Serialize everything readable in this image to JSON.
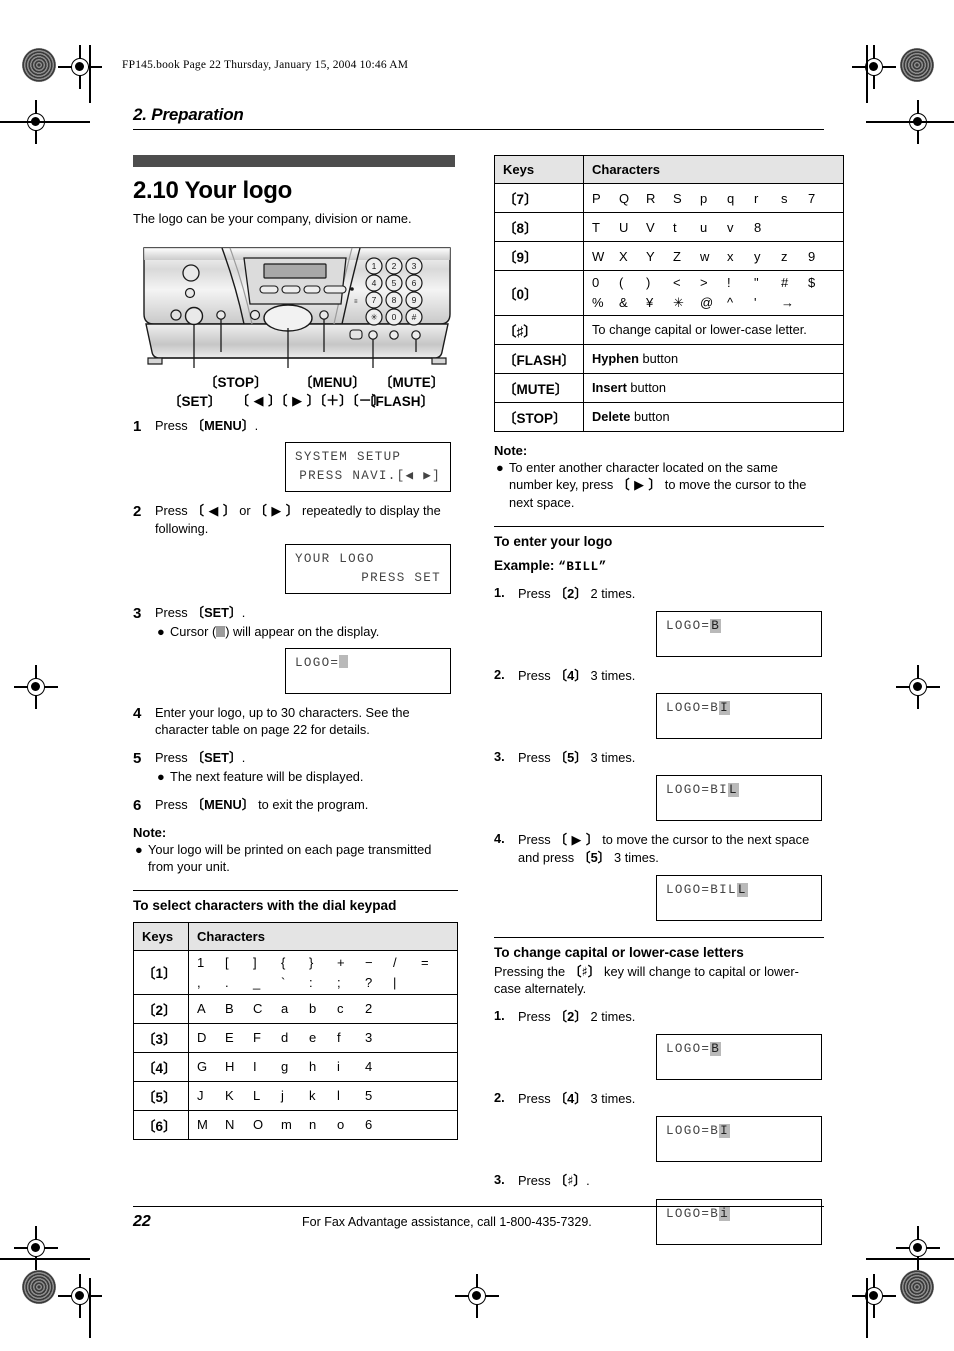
{
  "running_header": "FP145.book  Page 22  Thursday, January 15, 2004  10:46 AM",
  "chapter_title": "2. Preparation",
  "footer": {
    "page_number": "22",
    "text": "For Fax Advantage assistance, call 1-800-435-7329."
  },
  "section": {
    "number_title": "2.10 Your logo",
    "lead": "The logo can be your company, division or name."
  },
  "illustration": {
    "keypad_rows": [
      [
        "1",
        "2",
        "3"
      ],
      [
        "4",
        "5",
        "6"
      ],
      [
        "7",
        "8",
        "9"
      ],
      [
        "∗",
        "0",
        "#"
      ]
    ],
    "labels": {
      "stop": "〔STOP〕",
      "menu": "〔MENU〕",
      "mute": "〔MUTE〕",
      "set": "〔SET〕",
      "navi": "〔 ◀ 〕〔 ▶ 〕〔＋〕〔－〕",
      "flash": "〔FLASH〕"
    }
  },
  "steps": [
    {
      "n": "1",
      "text_before": "Press ",
      "key": "〔MENU〕",
      "text_after": "."
    },
    {
      "n": "2",
      "text_before": "Press ",
      "key": "〔 ◀ 〕",
      "mid": " or ",
      "key2": "〔 ▶ 〕",
      "text_after": " repeatedly to display the following."
    },
    {
      "n": "3",
      "text_before": "Press ",
      "key": "〔SET〕",
      "text_after": ".",
      "bullet_before": "Cursor (",
      "bullet_after": ") will appear on the display."
    },
    {
      "n": "4",
      "text": "Enter your logo, up to 30 characters. See the character table on page 22 for details."
    },
    {
      "n": "5",
      "text_before": "Press ",
      "key": "〔SET〕",
      "text_after": ".",
      "bullet": "The next feature will be displayed."
    },
    {
      "n": "6",
      "text_before": "Press ",
      "key": "〔MENU〕",
      "text_after": " to exit the program."
    }
  ],
  "lcds": {
    "step1": {
      "line1": "SYSTEM SETUP",
      "line2": "PRESS NAVI.[◀  ▶]"
    },
    "step2": {
      "line1": "YOUR LOGO",
      "line2": "PRESS SET"
    },
    "step3": {
      "line1": "LOGO=",
      "cursor": ""
    },
    "enter1": {
      "line1": "LOGO=",
      "cursor": "B"
    },
    "enter2": {
      "line1": "LOGO=B",
      "cursor": "I"
    },
    "enter3": {
      "line1": "LOGO=BI",
      "cursor": "L"
    },
    "enter4": {
      "line1": "LOGO=BIL",
      "cursor": "L"
    },
    "case1": {
      "line1": "LOGO=",
      "cursor": "B"
    },
    "case2": {
      "line1": "LOGO=B",
      "cursor": "I"
    },
    "case3": {
      "line1": "LOGO=B",
      "cursor": "i"
    }
  },
  "note_left": {
    "heading": "Note:",
    "bullet": "Your logo will be printed on each page transmitted from your unit."
  },
  "keypad_table_left": {
    "heading": "To select characters with the dial keypad",
    "columns": [
      "Keys",
      "Characters"
    ],
    "rows": [
      {
        "key": "〔1〕",
        "chars": [
          "1",
          "[",
          "]",
          "{",
          "}",
          "+",
          "−",
          "/",
          "="
        ],
        "chars2": [
          ",",
          ".",
          "_",
          "`",
          ":",
          ";",
          "?",
          "|"
        ]
      },
      {
        "key": "〔2〕",
        "chars": [
          "A",
          "B",
          "C",
          "a",
          "b",
          "c",
          "2"
        ]
      },
      {
        "key": "〔3〕",
        "chars": [
          "D",
          "E",
          "F",
          "d",
          "e",
          "f",
          "3"
        ]
      },
      {
        "key": "〔4〕",
        "chars": [
          "G",
          "H",
          "I",
          "g",
          "h",
          "i",
          "4"
        ]
      },
      {
        "key": "〔5〕",
        "chars": [
          "J",
          "K",
          "L",
          "j",
          "k",
          "l",
          "5"
        ]
      },
      {
        "key": "〔6〕",
        "chars": [
          "M",
          "N",
          "O",
          "m",
          "n",
          "o",
          "6"
        ]
      }
    ]
  },
  "keypad_table_right": {
    "columns": [
      "Keys",
      "Characters"
    ],
    "rows": [
      {
        "key": "〔7〕",
        "chars": [
          "P",
          "Q",
          "R",
          "S",
          "p",
          "q",
          "r",
          "s",
          "7"
        ]
      },
      {
        "key": "〔8〕",
        "chars": [
          "T",
          "U",
          "V",
          "t",
          "u",
          "v",
          "8"
        ]
      },
      {
        "key": "〔9〕",
        "chars": [
          "W",
          "X",
          "Y",
          "Z",
          "w",
          "x",
          "y",
          "z",
          "9"
        ]
      },
      {
        "key": "〔0〕",
        "chars": [
          "0",
          "(",
          ")",
          "<",
          ">",
          "!",
          "\"",
          "#",
          "$"
        ],
        "chars2": [
          "%",
          "&",
          "¥",
          "∗",
          "@",
          "^",
          "'",
          "→"
        ]
      },
      {
        "key": "〔♯〕",
        "desc": "To change capital or lower-case letter."
      },
      {
        "key": "〔FLASH〕",
        "desc_bold": "Hyphen",
        "desc_rest": " button"
      },
      {
        "key": "〔MUTE〕",
        "desc_bold": "Insert",
        "desc_rest": " button"
      },
      {
        "key": "〔STOP〕",
        "desc_bold": "Delete",
        "desc_rest": " button"
      }
    ]
  },
  "note_right": {
    "heading": "Note:",
    "bullet_a": "To enter another character located on the same number key, press ",
    "bullet_key": "〔 ▶ 〕",
    "bullet_b": " to move the cursor to the next space."
  },
  "enter_logo": {
    "heading": "To enter your logo",
    "example_label": "Example: ",
    "example_value": "“BILL”",
    "steps": [
      {
        "n": "1.",
        "before": "Press ",
        "key": "〔2〕",
        "after": " 2 times."
      },
      {
        "n": "2.",
        "before": "Press ",
        "key": "〔4〕",
        "after": " 3 times."
      },
      {
        "n": "3.",
        "before": "Press ",
        "key": "〔5〕",
        "after": " 3 times."
      },
      {
        "n": "4.",
        "before": "Press ",
        "key": "〔 ▶ 〕",
        "after": " to move the cursor to the next space and press ",
        "key2": "〔5〕",
        "after2": " 3 times."
      }
    ]
  },
  "change_case": {
    "heading": "To change capital or lower-case letters",
    "intro_before": "Pressing the ",
    "intro_key": "〔♯〕",
    "intro_after": " key will change to capital or lower-case alternately.",
    "steps": [
      {
        "n": "1.",
        "before": "Press ",
        "key": "〔2〕",
        "after": " 2 times."
      },
      {
        "n": "2.",
        "before": "Press ",
        "key": "〔4〕",
        "after": " 3 times."
      },
      {
        "n": "3.",
        "before": "Press ",
        "key": "〔♯〕",
        "after": "."
      }
    ]
  },
  "colors": {
    "section_bar": "#4d4d4d",
    "table_header": "#e4e4e4",
    "lcd_cursor": "#b9b9b9"
  }
}
